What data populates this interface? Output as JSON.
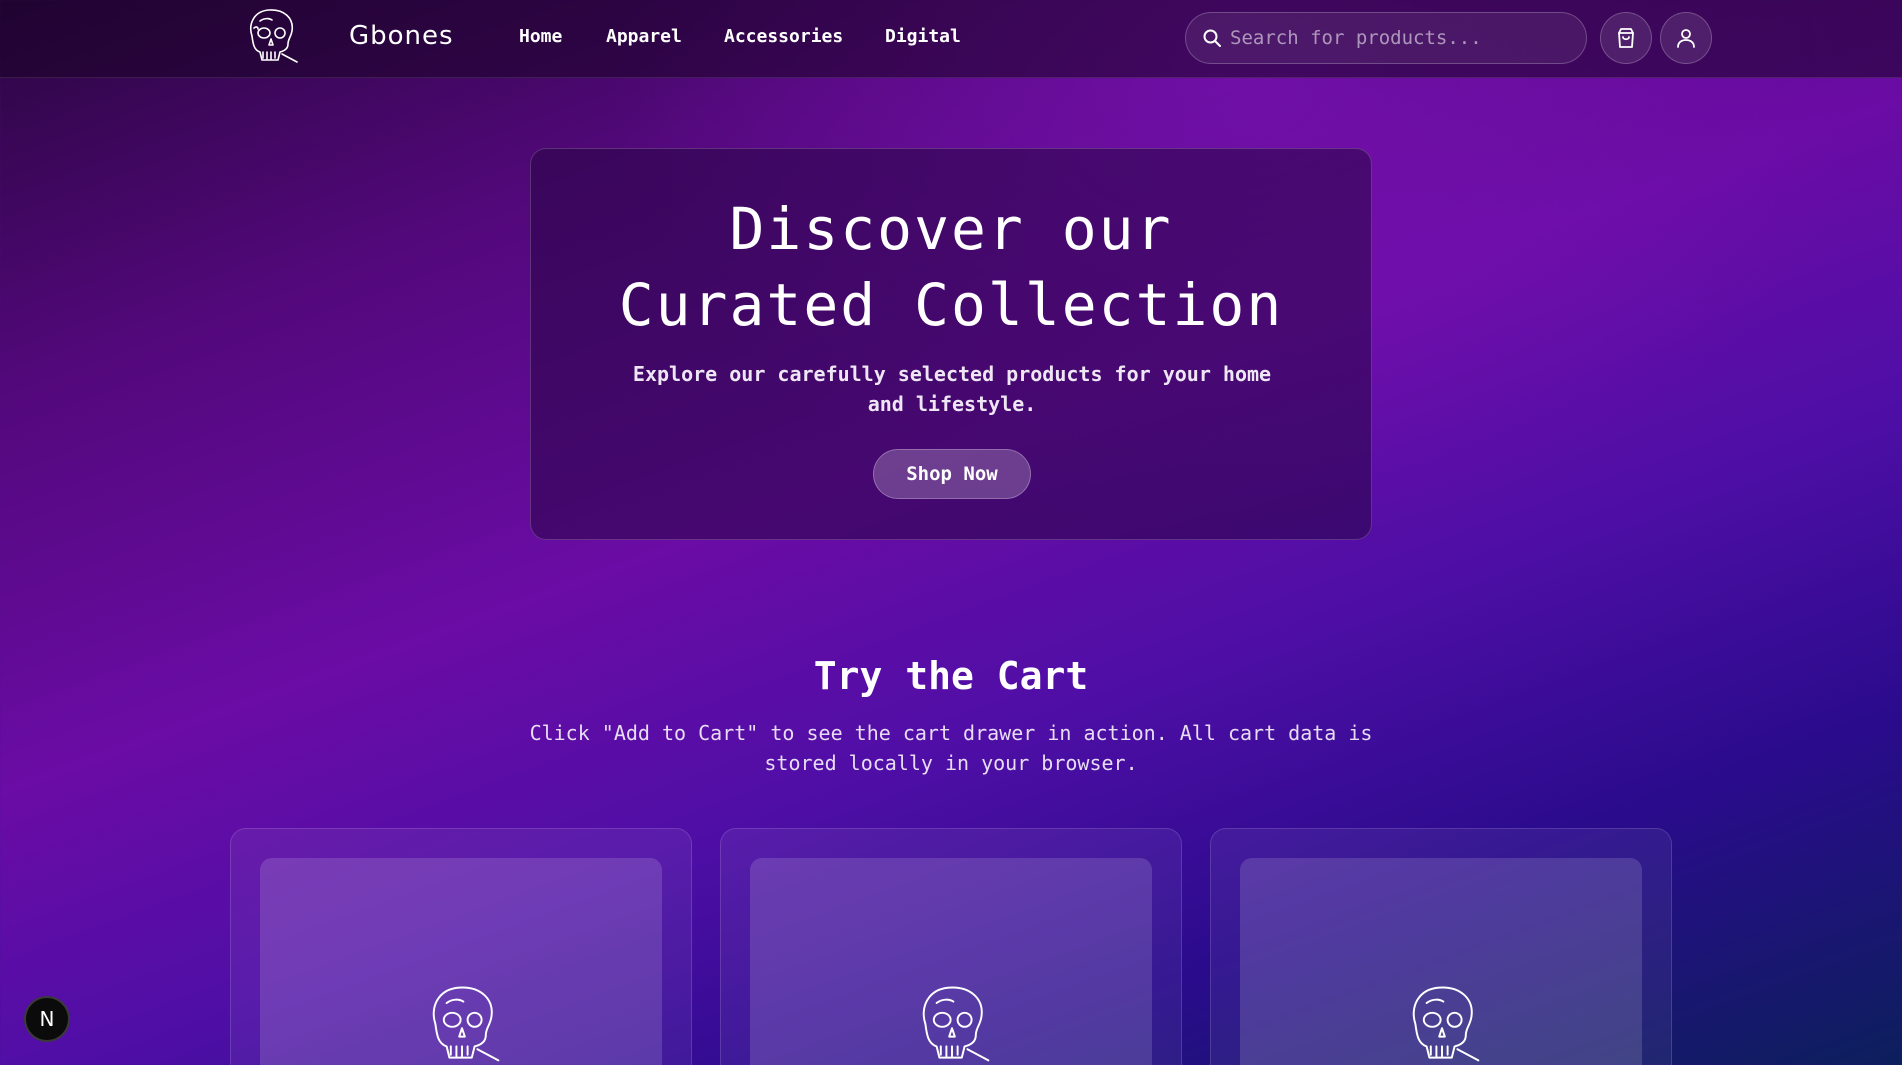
{
  "header": {
    "brand": "Gbones",
    "logo_icon": "skull-icon",
    "nav": [
      {
        "label": "Home"
      },
      {
        "label": "Apparel"
      },
      {
        "label": "Accessories"
      },
      {
        "label": "Digital"
      }
    ],
    "search": {
      "placeholder": "Search for products...",
      "value": "",
      "icon": "search-icon"
    },
    "cart_icon": "shopping-bag-icon",
    "user_icon": "user-icon"
  },
  "hero": {
    "title_line1": "Discover our",
    "title_line2": "Curated Collection",
    "subtitle": "Explore our carefully selected products for your home and lifestyle.",
    "cta_label": "Shop Now"
  },
  "cart_section": {
    "title": "Try the Cart",
    "subtitle": "Click \"Add to Cart\" to see the cart drawer in action. All cart data is stored locally in your browser.",
    "product_image_icon": "skull-icon"
  },
  "dev_badge": {
    "label": "N"
  },
  "colors": {
    "background_start": "#2a0640",
    "background_mid": "#6a0ca5",
    "background_end": "#0c1f5c",
    "text": "#ffffff"
  }
}
